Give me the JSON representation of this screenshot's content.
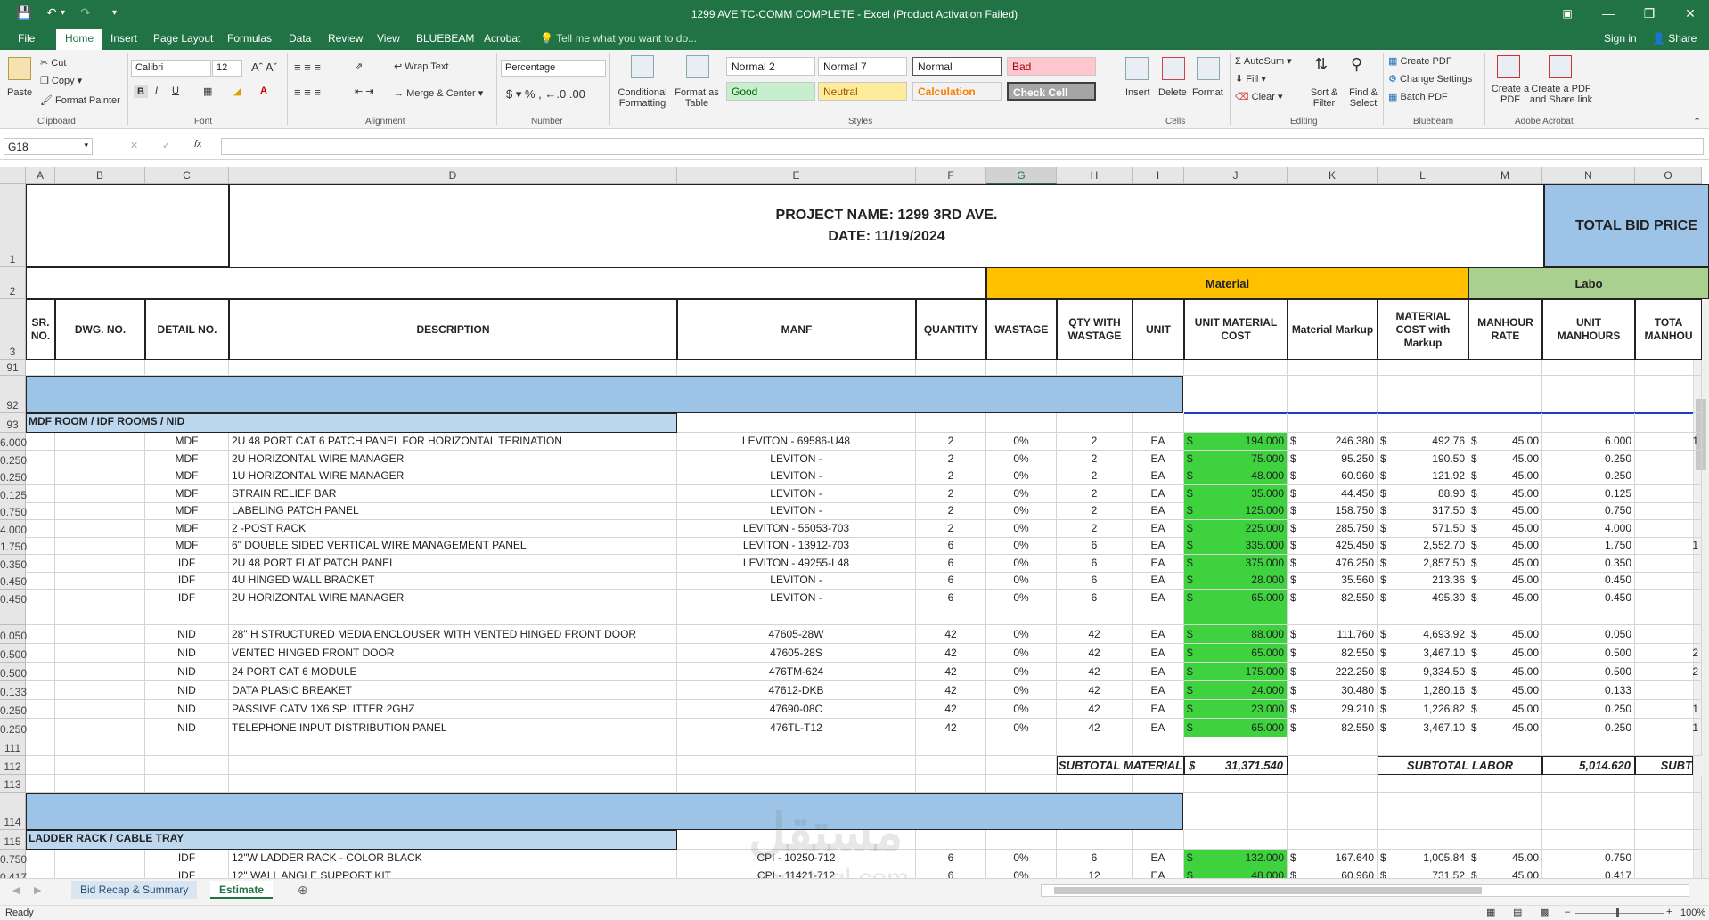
{
  "window": {
    "title": "1299 AVE TC-COMM COMPLETE - Excel (Product Activation Failed)",
    "signin": "Sign in",
    "share": "Share"
  },
  "menu": [
    "File",
    "Home",
    "Insert",
    "Page Layout",
    "Formulas",
    "Data",
    "Review",
    "View",
    "BLUEBEAM",
    "Acrobat"
  ],
  "tell_me": "Tell me what you want to do...",
  "ribbon": {
    "clipboard": {
      "paste": "Paste",
      "cut": "Cut",
      "copy": "Copy",
      "format_painter": "Format Painter",
      "label": "Clipboard"
    },
    "font": {
      "name": "Calibri",
      "size": "12",
      "label": "Font"
    },
    "alignment": {
      "wrap": "Wrap Text",
      "merge": "Merge & Center",
      "label": "Alignment"
    },
    "number": {
      "format": "Percentage",
      "label": "Number"
    },
    "styles": {
      "conditional": "Conditional Formatting",
      "format_table": "Format as Table",
      "label": "Styles",
      "cells": [
        "Normal 2",
        "Normal 7",
        "Normal",
        "Bad",
        "Good",
        "Neutral",
        "Calculation",
        "Check Cell"
      ]
    },
    "cells": {
      "insert": "Insert",
      "delete": "Delete",
      "format": "Format",
      "label": "Cells"
    },
    "editing": {
      "autosum": "AutoSum",
      "fill": "Fill",
      "clear": "Clear",
      "sort": "Sort & Filter",
      "find": "Find & Select",
      "label": "Editing"
    },
    "bluebeam": {
      "create": "Create PDF",
      "change": "Change Settings",
      "batch": "Batch PDF",
      "label": "Bluebeam"
    },
    "acrobat": {
      "create": "Create a PDF",
      "share": "Create a PDF and Share link",
      "label": "Adobe Acrobat"
    }
  },
  "namebox": "G18",
  "columns": [
    "A",
    "B",
    "C",
    "D",
    "E",
    "F",
    "G",
    "H",
    "I",
    "J",
    "K",
    "L",
    "M",
    "N",
    "O"
  ],
  "header": {
    "project": "PROJECT NAME:  1299 3RD AVE.",
    "date": "DATE: 11/19/2024",
    "total_bid": "TOTAL BID PRICE",
    "material": "Material",
    "labor": "Labo",
    "cols": [
      "SR. NO.",
      "DWG. NO.",
      "DETAIL NO.",
      "DESCRIPTION",
      "MANF",
      "QUANTITY",
      "WASTAGE",
      "QTY WITH WASTAGE",
      "UNIT",
      "UNIT MATERIAL COST",
      "Material Markup",
      "MATERIAL COST with Markup",
      "MANHOUR RATE",
      "UNIT MANHOURS",
      "TOTA MANHOU"
    ]
  },
  "row_numbers": {
    "r1": "1",
    "r2": "2",
    "r3": "3",
    "r91": "91",
    "r92": "92",
    "r93": "93",
    "r111": "111",
    "r112": "112",
    "r113": "113",
    "r114": "114",
    "r115": "115"
  },
  "section1": "MDF ROOM / IDF ROOMS / NID",
  "section2": "LADDER RACK  / CABLE TRAY",
  "rows": [
    {
      "n": "6.000",
      "c": "MDF",
      "d": "2U 48 PORT CAT 6 PATCH PANEL FOR HORIZONTAL TERINATION",
      "e": "LEVITON - 69586-U48",
      "f": "2",
      "g": "0%",
      "h": "2",
      "i": "EA",
      "j": "194.000",
      "k": "246.380",
      "l": "492.76",
      "m": "45.00",
      "o": "1"
    },
    {
      "n": "0.250",
      "c": "MDF",
      "d": "2U HORIZONTAL WIRE MANAGER",
      "e": "LEVITON -",
      "f": "2",
      "g": "0%",
      "h": "2",
      "i": "EA",
      "j": "75.000",
      "k": "95.250",
      "l": "190.50",
      "m": "45.00",
      "o": ""
    },
    {
      "n": "0.250",
      "c": "MDF",
      "d": "1U HORIZONTAL WIRE MANAGER",
      "e": "LEVITON -",
      "f": "2",
      "g": "0%",
      "h": "2",
      "i": "EA",
      "j": "48.000",
      "k": "60.960",
      "l": "121.92",
      "m": "45.00",
      "o": ""
    },
    {
      "n": "0.125",
      "c": "MDF",
      "d": "STRAIN RELIEF BAR",
      "e": "LEVITON -",
      "f": "2",
      "g": "0%",
      "h": "2",
      "i": "EA",
      "j": "35.000",
      "k": "44.450",
      "l": "88.90",
      "m": "45.00",
      "o": ""
    },
    {
      "n": "0.750",
      "c": "MDF",
      "d": "LABELING PATCH PANEL",
      "e": "LEVITON -",
      "f": "2",
      "g": "0%",
      "h": "2",
      "i": "EA",
      "j": "125.000",
      "k": "158.750",
      "l": "317.50",
      "m": "45.00",
      "o": ""
    },
    {
      "n": "4.000",
      "c": "MDF",
      "d": "2 -POST RACK",
      "e": "LEVITON - 55053-703",
      "f": "2",
      "g": "0%",
      "h": "2",
      "i": "EA",
      "j": "225.000",
      "k": "285.750",
      "l": "571.50",
      "m": "45.00",
      "o": ""
    },
    {
      "n": "1.750",
      "c": "MDF",
      "d": "6\" DOUBLE SIDED VERTICAL WIRE MANAGEMENT PANEL",
      "e": "LEVITON - 13912-703",
      "f": "6",
      "g": "0%",
      "h": "6",
      "i": "EA",
      "j": "335.000",
      "k": "425.450",
      "l": "2,552.70",
      "m": "45.00",
      "o": "1"
    },
    {
      "n": "0.350",
      "c": "IDF",
      "d": "2U 48 PORT FLAT PATCH PANEL",
      "e": "LEVITON - 49255-L48",
      "f": "6",
      "g": "0%",
      "h": "6",
      "i": "EA",
      "j": "375.000",
      "k": "476.250",
      "l": "2,857.50",
      "m": "45.00",
      "o": ""
    },
    {
      "n": "0.450",
      "c": "IDF",
      "d": "4U HINGED WALL BRACKET",
      "e": "LEVITON -",
      "f": "6",
      "g": "0%",
      "h": "6",
      "i": "EA",
      "j": "28.000",
      "k": "35.560",
      "l": "213.36",
      "m": "45.00",
      "o": ""
    },
    {
      "n": "0.450",
      "c": "IDF",
      "d": "2U HORIZONTAL WIRE MANAGER",
      "e": "LEVITON -",
      "f": "6",
      "g": "0%",
      "h": "6",
      "i": "EA",
      "j": "65.000",
      "k": "82.550",
      "l": "495.30",
      "m": "45.00",
      "o": ""
    },
    {
      "n": "",
      "c": "",
      "d": "",
      "e": "",
      "f": "",
      "g": "",
      "h": "",
      "i": "",
      "j": "",
      "k": "",
      "l": "",
      "m": "",
      "o": ""
    },
    {
      "n": "0.050",
      "c": "NID",
      "d": "28\" H STRUCTURED MEDIA  ENCLOUSER WITH VENTED HINGED FRONT DOOR",
      "e": "47605-28W",
      "f": "42",
      "g": "0%",
      "h": "42",
      "i": "EA",
      "j": "88.000",
      "k": "111.760",
      "l": "4,693.92",
      "m": "45.00",
      "o": ""
    },
    {
      "n": "0.500",
      "c": "NID",
      "d": "VENTED HINGED FRONT DOOR",
      "e": "47605-28S",
      "f": "42",
      "g": "0%",
      "h": "42",
      "i": "EA",
      "j": "65.000",
      "k": "82.550",
      "l": "3,467.10",
      "m": "45.00",
      "o": "2"
    },
    {
      "n": "0.500",
      "c": "NID",
      "d": "24 PORT CAT 6 MODULE",
      "e": "476TM-624",
      "f": "42",
      "g": "0%",
      "h": "42",
      "i": "EA",
      "j": "175.000",
      "k": "222.250",
      "l": "9,334.50",
      "m": "45.00",
      "o": "2"
    },
    {
      "n": "0.133",
      "c": "NID",
      "d": "DATA PLASIC BREAKET",
      "e": "47612-DKB",
      "f": "42",
      "g": "0%",
      "h": "42",
      "i": "EA",
      "j": "24.000",
      "k": "30.480",
      "l": "1,280.16",
      "m": "45.00",
      "o": ""
    },
    {
      "n": "0.250",
      "c": "NID",
      "d": "PASSIVE CATV 1X6 SPLITTER 2GHZ",
      "e": "47690-08C",
      "f": "42",
      "g": "0%",
      "h": "42",
      "i": "EA",
      "j": "23.000",
      "k": "29.210",
      "l": "1,226.82",
      "m": "45.00",
      "o": "1"
    },
    {
      "n": "0.250",
      "c": "NID",
      "d": "TELEPHONE  INPUT DISTRIBUTION PANEL",
      "e": "476TL-T12",
      "f": "42",
      "g": "0%",
      "h": "42",
      "i": "EA",
      "j": "65.000",
      "k": "82.550",
      "l": "3,467.10",
      "m": "45.00",
      "o": "1"
    }
  ],
  "subtotal": {
    "material_label": "SUBTOTAL MATERIAL",
    "material_value": "31,371.540",
    "labor_label": "SUBTOTAL LABOR",
    "labor_value": "5,014.620",
    "sub": "SUBT"
  },
  "row116": {
    "n": "0.750",
    "c": "IDF",
    "d": "12\"W LADDER RACK - COLOR BLACK",
    "e": "CPI - 10250-712",
    "f": "6",
    "g": "0%",
    "h": "6",
    "i": "EA",
    "j": "132.000",
    "k": "167.640",
    "l": "1,005.84",
    "m": "45.00",
    "o": ""
  },
  "row117": {
    "n": "0.417",
    "c": "IDF",
    "d": "12\" WALL ANGLE SUPPORT KIT",
    "e": "CPI - 11421-712",
    "f": "6",
    "g": "0%",
    "h": "12",
    "i": "EA",
    "j": "48.000",
    "k": "60.960",
    "l": "731.52",
    "m": "45.00",
    "o": ""
  },
  "dollar": "$",
  "sheets": [
    "Bid Recap & Summary",
    "Estimate"
  ],
  "status": {
    "ready": "Ready",
    "zoom": "100%"
  },
  "watermark": {
    "ar": "مستقل",
    "en": "mostaql.com"
  }
}
